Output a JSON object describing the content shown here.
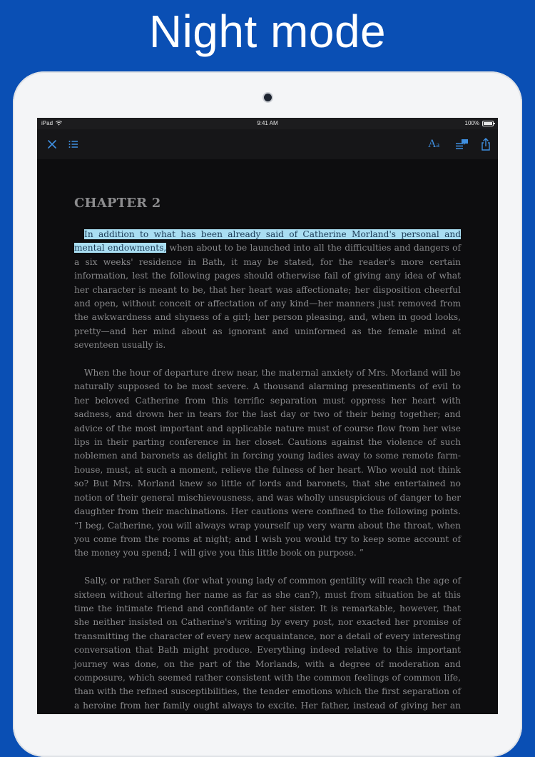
{
  "promo": {
    "headline": "Night mode"
  },
  "status_bar": {
    "device": "iPad",
    "time": "9:41 AM",
    "battery": "100%"
  },
  "toolbar": {
    "close_icon": "close-icon",
    "toc_icon": "list-icon",
    "font_label_big": "A",
    "font_label_small": "a",
    "notes_icon": "notes-icon",
    "share_icon": "share-icon",
    "accent": "#3f8fe0"
  },
  "reader": {
    "chapter_title": "CHAPTER 2",
    "highlight_color": "#a9def2",
    "paragraphs": [
      {
        "highlight": "In addition to what has been already said of Catherine Morland's personal and mental endowments,",
        "text": " when about to be launched into all the difficulties and dangers of a six weeks' residence in Bath, it may be stated, for the reader's more certain information, lest the following pages should otherwise fail of giving any idea of what her character is meant to be, that her heart was affectionate; her disposition cheerful and open, without conceit or affectation of any kind—her manners just removed from the awkwardness and shyness of a girl; her person pleasing, and, when in good looks, pretty—and her mind about as ignorant and uninformed as the female mind at seventeen usually is."
      },
      {
        "text": "When the hour of departure drew near, the maternal anxiety of Mrs. Morland will be naturally supposed to be most severe. A thousand alarming presentiments of evil to her beloved Catherine from this terrific separation must oppress her heart with sadness, and drown her in tears for the last day or two of their being together; and advice of the most important and applicable nature must of course flow from her wise lips in their parting conference in her closet. Cautions against the violence of such noblemen and baronets as delight in forcing young ladies away to some remote farm-house, must, at such a moment, relieve the fulness of her heart. Who would not think so? But Mrs. Morland knew so little of lords and baronets, that she entertained no notion of their general mischievousness, and was wholly unsuspicious of danger to her daughter from their machinations. Her cautions were confined to the following points. “I beg, Catherine, you will always wrap yourself up very warm about the throat, when you come from the rooms at night; and I wish you would try to keep some account of the money you spend; I will give you this little book on purpose. ”"
      },
      {
        "text": "Sally, or rather Sarah (for what young lady of common gentility will reach the age of sixteen without altering her name as far as she can?), must from situation be at this time the intimate friend and confidante of her sister. It is remarkable, however, that she neither insisted on Catherine's writing by every post, nor exacted her promise of transmitting the character of every new acquaintance, nor a detail of every interesting conversation that Bath might produce. Everything indeed relative to this important journey was done, on the part of the Morlands, with a degree of moderation and composure, which seemed rather consistent with the common feelings of common life, than with the refined susceptibilities, the tender emotions which the first separation of a heroine from her family ought always to excite. Her father, instead of giving her an unlimited order on his banker, or even putting an hundred pounds bank-bill into her hands, gave her only ten guineas, and promised her more when she wanted it."
      }
    ]
  }
}
